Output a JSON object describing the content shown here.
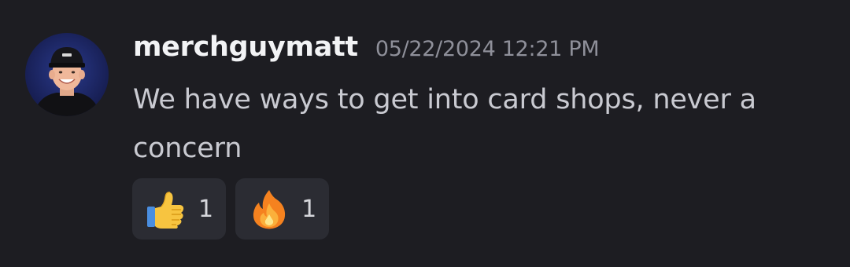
{
  "message": {
    "username": "merchguymatt",
    "timestamp": "05/22/2024 12:21 PM",
    "text": "We have ways to get into card shops, never a concern"
  },
  "reactions": [
    {
      "emoji": "thumbs-up",
      "count": "1"
    },
    {
      "emoji": "fire",
      "count": "1"
    }
  ]
}
